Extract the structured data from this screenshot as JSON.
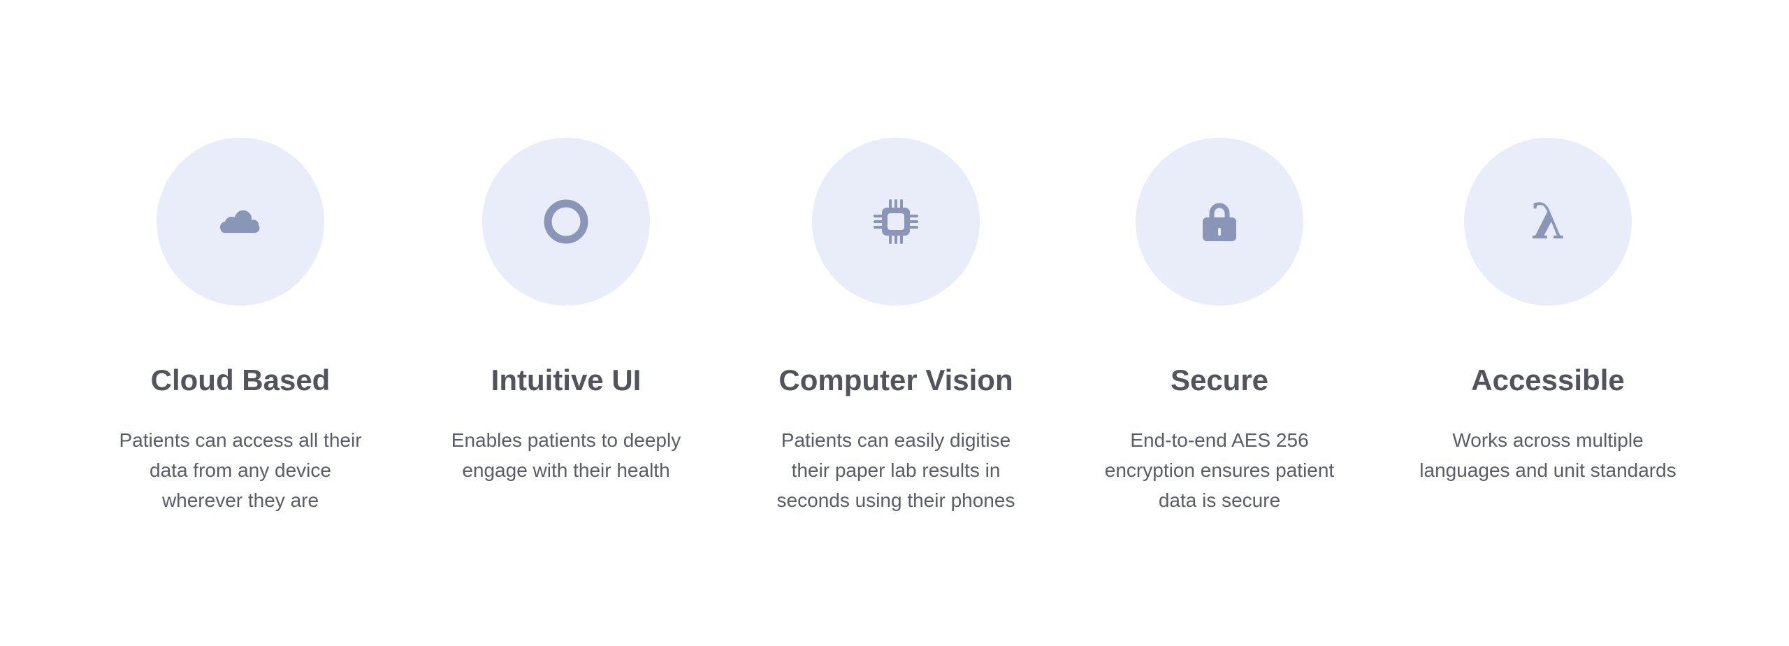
{
  "colors": {
    "circle_bg": "#e9edf9",
    "icon": "#8a96b8",
    "title": "#51545c",
    "text": "#5a5d66"
  },
  "features": [
    {
      "icon": "cloud-icon",
      "title": "Cloud Based",
      "lines": [
        "Patients can access all their",
        "data from any device",
        "wherever they are"
      ]
    },
    {
      "icon": "circle-icon",
      "title": "Intuitive UI",
      "lines": [
        "Enables patients to deeply",
        "engage with their health"
      ]
    },
    {
      "icon": "chip-icon",
      "title": "Computer Vision",
      "lines": [
        "Patients can easily digitise",
        "their paper lab results in",
        "seconds using their phones"
      ]
    },
    {
      "icon": "lock-icon",
      "title": "Secure",
      "lines": [
        "End-to-end AES 256",
        "encryption ensures patient",
        "data is secure"
      ]
    },
    {
      "icon": "lambda-icon",
      "title": "Accessible",
      "lines": [
        "Works across multiple",
        "languages and unit standards"
      ],
      "glyph": "λ"
    }
  ]
}
